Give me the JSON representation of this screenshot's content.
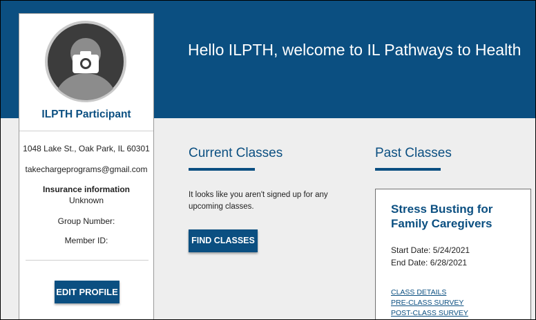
{
  "header": {
    "welcome": "Hello ILPTH, welcome to IL Pathways to Health"
  },
  "profile": {
    "name": "ILPTH Participant",
    "address": "1048 Lake St., Oak Park, IL 60301",
    "email": "takechargeprograms@gmail.com",
    "insurance_heading": "Insurance information",
    "insurance_value": "Unknown",
    "group_label": "Group Number:",
    "member_label": "Member ID:",
    "edit_button": "EDIT PROFILE",
    "avatar_icon": "camera-icon"
  },
  "current_classes": {
    "title": "Current Classes",
    "message": "It looks like you aren't signed up for any upcoming classes.",
    "find_button": "FIND CLASSES"
  },
  "past_classes": {
    "title": "Past Classes",
    "card": {
      "title": "Stress Busting for Family Caregivers",
      "start": "Start Date: 5/24/2021",
      "end": "End Date: 6/28/2021",
      "links": [
        "CLASS DETAILS",
        "PRE-CLASS SURVEY",
        "POST-CLASS SURVEY"
      ]
    }
  },
  "colors": {
    "brand": "#0b4f81",
    "background": "#eeeeee"
  }
}
